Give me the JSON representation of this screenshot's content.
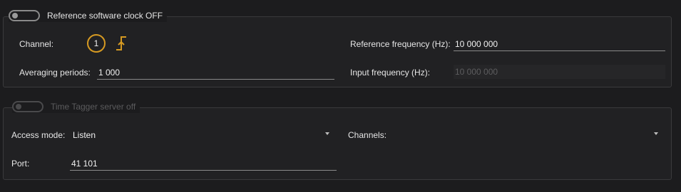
{
  "reference_clock": {
    "toggle_label": "Reference software clock OFF",
    "channel_label": "Channel:",
    "channel_value": "1",
    "averaging_label": "Averaging periods:",
    "averaging_value": "1 000",
    "ref_freq_label": "Reference frequency (Hz):",
    "ref_freq_value": "10 000 000",
    "input_freq_label": "Input frequency (Hz):",
    "input_freq_value": "10 000 000"
  },
  "server": {
    "toggle_label": "Time Tagger server off",
    "access_mode_label": "Access mode:",
    "access_mode_value": "Listen",
    "channels_label": "Channels:",
    "channels_value": "",
    "port_label": "Port:",
    "port_value": "41 101"
  },
  "colors": {
    "background": "#1c1c1e",
    "accent": "#d69a22"
  },
  "icons": {
    "edge": "rising-edge-icon",
    "dropdown": "chevron-down-icon"
  }
}
